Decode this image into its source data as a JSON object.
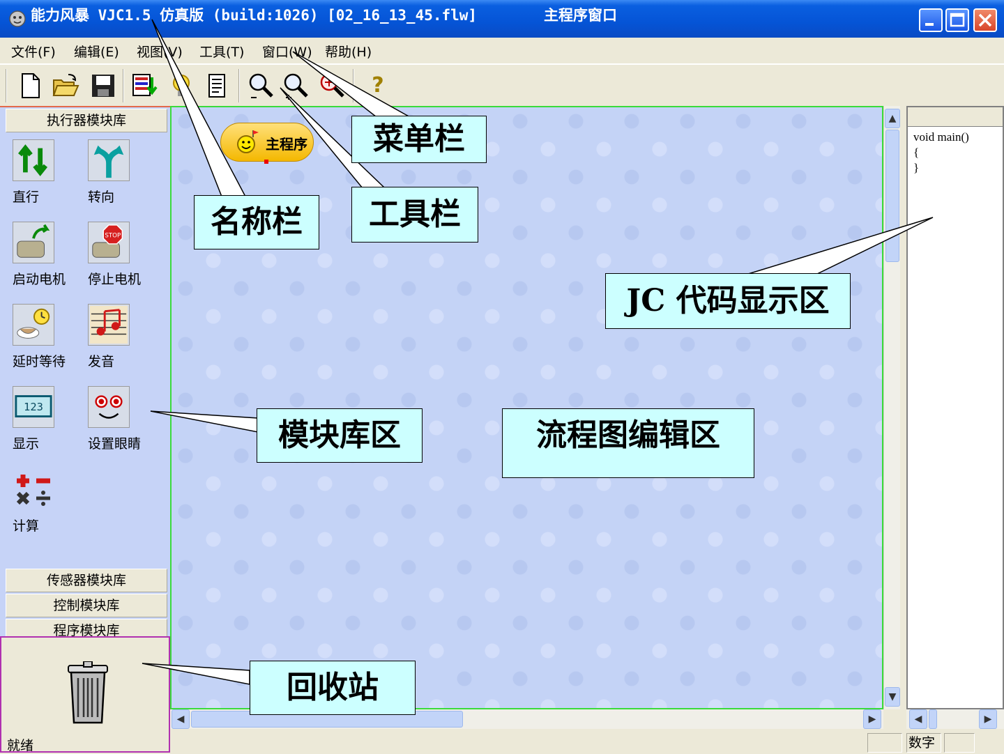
{
  "window": {
    "title": "能力风暴 VJC1.5 仿真版 (build:1026) [02_16_13_45.flw]",
    "subtitle": "主程序窗口"
  },
  "menu": [
    "文件(F)",
    "编辑(E)",
    "视图(V)",
    "工具(T)",
    "窗口(W)",
    "帮助(H)"
  ],
  "toolbar": {
    "icons": [
      "new-file-icon",
      "open-folder-icon",
      "save-icon",
      "download-icon",
      "bulb-icon",
      "script-icon",
      "zoom-out-icon",
      "zoom-in-icon",
      "zoom-fit-icon",
      "help-icon"
    ],
    "help_glyph": "?"
  },
  "library": {
    "active_header": "执行器模块库",
    "modules": [
      {
        "label": "直行",
        "icon": "straight-arrows-icon"
      },
      {
        "label": "转向",
        "icon": "turn-arrow-icon"
      },
      {
        "label": "启动电机",
        "icon": "start-motor-icon"
      },
      {
        "label": "停止电机",
        "icon": "stop-motor-icon"
      },
      {
        "label": "延时等待",
        "icon": "delay-clock-icon"
      },
      {
        "label": "发音",
        "icon": "music-notes-icon"
      },
      {
        "label": "显示",
        "icon": "display-123-icon"
      },
      {
        "label": "设置眼睛",
        "icon": "eyes-face-icon"
      },
      {
        "label": "计算",
        "icon": "calculator-icon"
      }
    ],
    "display_value": "123",
    "stop_text": "STOP",
    "other_headers": [
      "传感器模块库",
      "控制模块库",
      "程序模块库"
    ]
  },
  "canvas": {
    "main_block": "主程序"
  },
  "code": {
    "lines": [
      "void main()",
      "{",
      "}"
    ]
  },
  "status": {
    "left_text": "就绪",
    "num_indicator": "数字"
  },
  "callouts": {
    "menubar": "菜单栏",
    "titlebar": "名称栏",
    "toolbar": "工具栏",
    "code_area": "JC 代码显示区",
    "library": "模块库区",
    "flowchart": "流程图编辑区",
    "recycle": "回收站"
  },
  "colors": {
    "titlebar": "#0554d6",
    "canvas_bg": "#c4d3f6",
    "callout_bg": "#ccffff",
    "callout_text": "#000000",
    "canvas_border": "#3adb3a",
    "recycle_border": "#b030b0"
  }
}
